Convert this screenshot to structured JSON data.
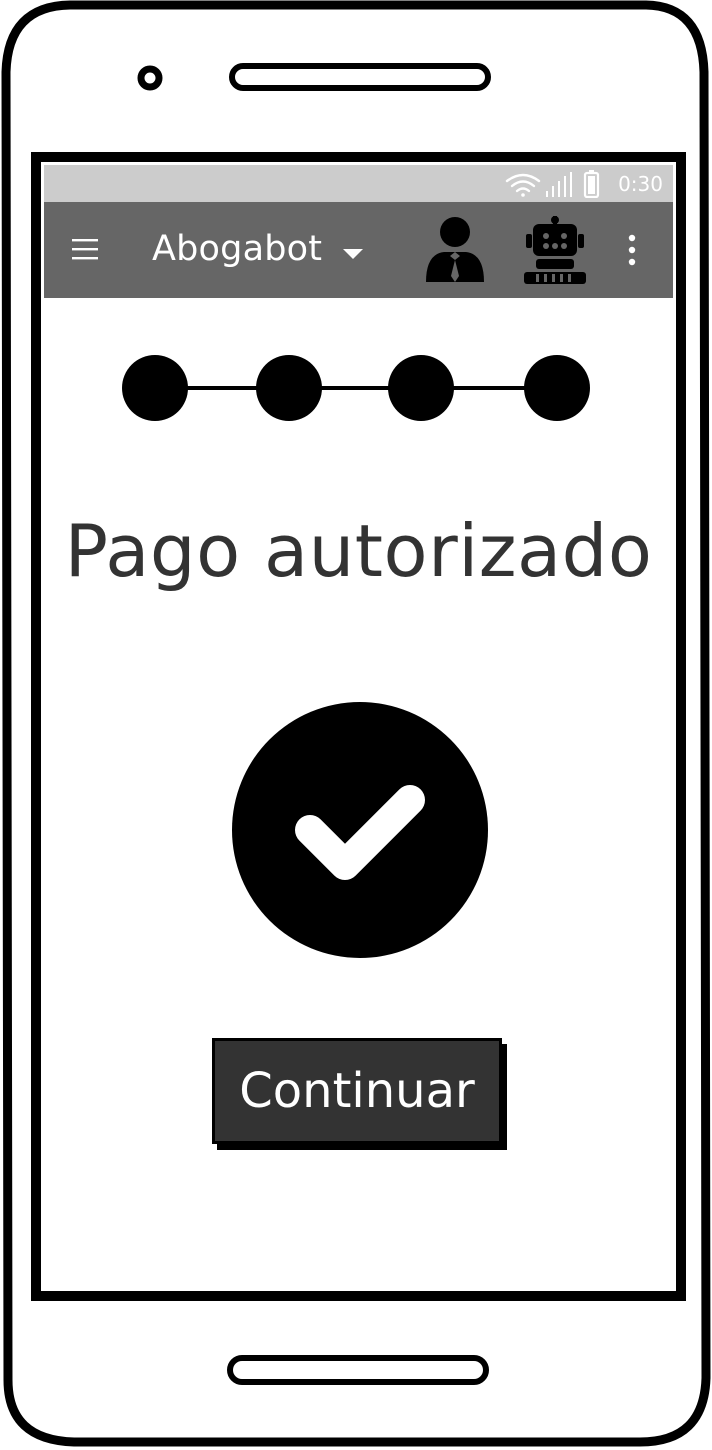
{
  "status_bar": {
    "time": "0:30",
    "icons": [
      "wifi-icon",
      "signal-icon",
      "battery-icon"
    ],
    "background": "#cccccc"
  },
  "app_bar": {
    "title": "Abogabot",
    "icons": [
      "menu-icon",
      "chevron-down-icon",
      "lawyer-icon",
      "robot-icon",
      "more-vert-icon"
    ],
    "background": "#666666"
  },
  "stepper": {
    "steps": 4,
    "completed": 4
  },
  "main": {
    "title": "Pago autorizado",
    "status_icon": "check-circle-icon",
    "continue_label": "Continuar"
  },
  "colors": {
    "primary_dark": "#000000",
    "text_dark": "#333333",
    "button_bg": "#333333",
    "button_text": "#ffffff"
  }
}
